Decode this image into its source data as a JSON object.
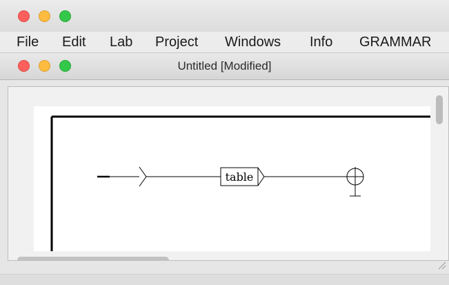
{
  "window": {
    "title": "Untitled [Modified]"
  },
  "menubar": {
    "items": [
      "File",
      "Edit",
      "Lab",
      "Project",
      "Windows",
      "Info",
      "GRAMMAR"
    ]
  },
  "graph": {
    "box_label": "table"
  },
  "colors": {
    "close": "#fc605c",
    "minimize": "#fdbc40",
    "zoom": "#34c84a",
    "canvas": "#ffffff"
  },
  "icons": [
    "initial-state-arrow-icon",
    "final-state-icon"
  ]
}
